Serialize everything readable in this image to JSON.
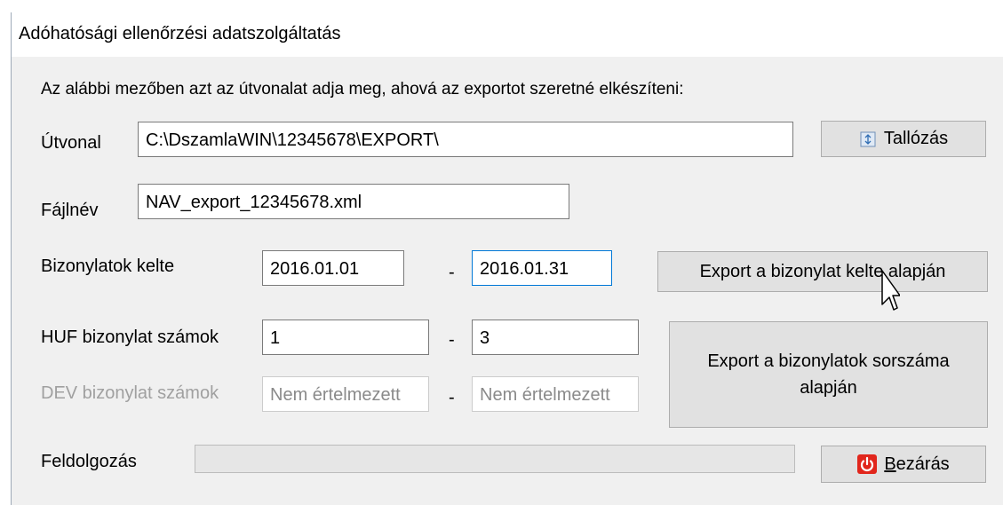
{
  "window": {
    "title": "Adóhatósági ellenőrzési adatszolgáltatás"
  },
  "instruction": "Az alábbi mezőben azt az útvonalat adja meg, ahová az exportot szeretné elkészíteni:",
  "path": {
    "label": "Útvonal",
    "value": "C:\\DszamlaWIN\\12345678\\EXPORT\\"
  },
  "browse_button": {
    "label": "Tallózás",
    "icon": "browse-icon"
  },
  "filename": {
    "label": "Fájlnév",
    "value": "NAV_export_12345678.xml"
  },
  "dates": {
    "label": "Bizonylatok kelte",
    "from": "2016.01.01",
    "separator": "-",
    "to": "2016.01.31"
  },
  "export_by_date_button": {
    "label": "Export a bizonylat kelte alapján"
  },
  "huf_numbers": {
    "label": "HUF bizonylat számok",
    "from": "1",
    "separator": "-",
    "to": "3"
  },
  "dev_numbers": {
    "label": "DEV bizonylat számok",
    "from": "Nem értelmezett",
    "separator": "-",
    "to": "Nem értelmezett"
  },
  "export_by_number_button": {
    "line1": "Export a bizonylatok sorszáma",
    "line2": "alapján"
  },
  "processing": {
    "label": "Feldolgozás",
    "progress": 0
  },
  "close_button": {
    "label": "Bezárás",
    "icon": "power-icon"
  },
  "colors": {
    "focus_border": "#0078d7",
    "close_icon": "#e1261c",
    "button_face": "#e1e1e1"
  }
}
